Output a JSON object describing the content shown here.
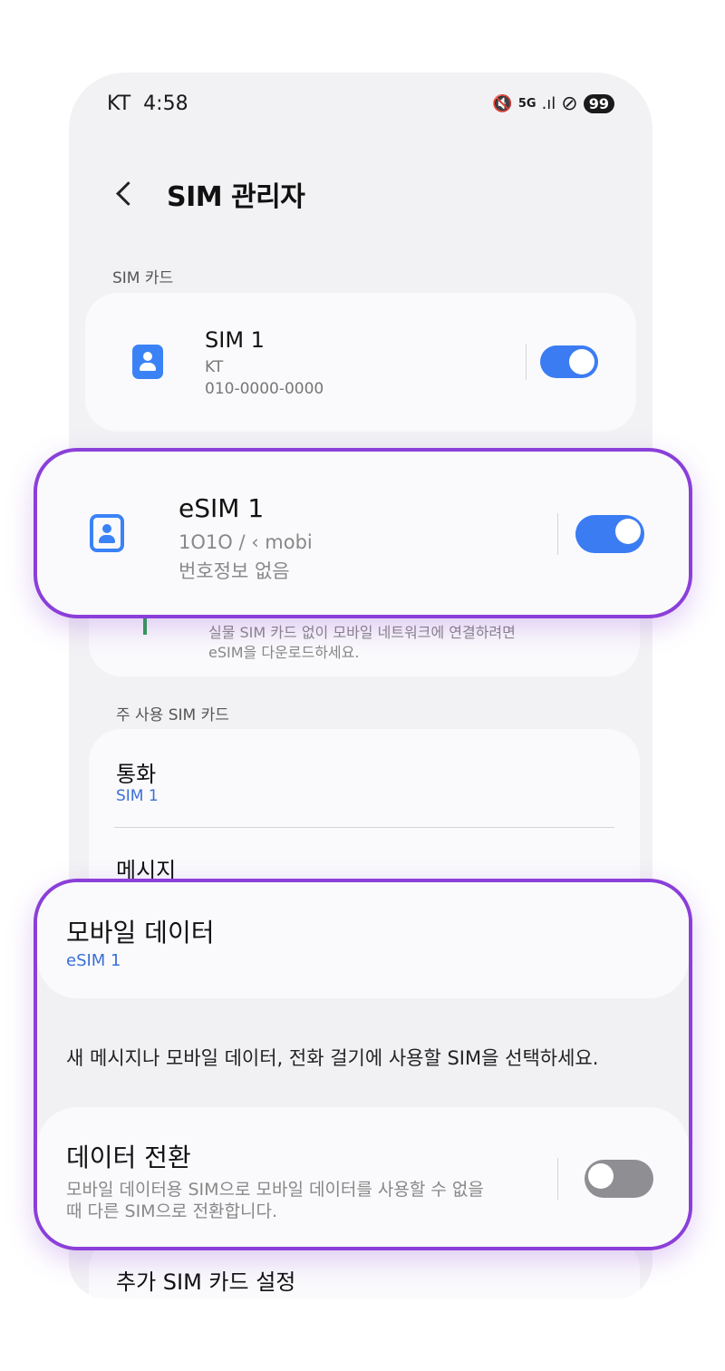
{
  "status_bar": {
    "carrier": "KT",
    "time": "4:58",
    "icons": [
      "mute-icon",
      "5g-icon",
      "signal-icon",
      "dnd-icon"
    ],
    "battery": "99"
  },
  "header": {
    "title": "SIM 관리자"
  },
  "sim_cards_section": {
    "label": "SIM 카드"
  },
  "sim1": {
    "name": "SIM 1",
    "carrier": "KT",
    "number": "010-0000-0000",
    "enabled": true
  },
  "esim1": {
    "name": "eSIM 1",
    "carrier": "1O1O / ‹ mobi",
    "number": "번호정보 없음",
    "enabled": true
  },
  "add_esim": {
    "description_line1": "실물 SIM 카드 없이 모바일 네트워크에 연결하려면",
    "description_line2": "eSIM을 다운로드하세요."
  },
  "primary_section": {
    "label": "주 사용 SIM 카드",
    "calls": {
      "label": "통화",
      "value": "SIM 1"
    },
    "messages": {
      "label": "메시지"
    }
  },
  "mobile_data": {
    "label": "모바일 데이터",
    "value": "eSIM 1"
  },
  "hint": "새 메시지나 모바일 데이터, 전화 걸기에 사용할 SIM을 선택하세요.",
  "data_switch": {
    "label": "데이터 전환",
    "description_line1": "모바일 데이터용 SIM으로 모바일 데이터를 사용할 수 없을",
    "description_line2": "때 다른 SIM으로 전환합니다.",
    "enabled": false
  },
  "more_settings": {
    "label": "추가 SIM 카드 설정"
  },
  "colors": {
    "accent": "#3b7cf3",
    "highlight": "#8b3fd9",
    "background": "#f2f2f4"
  }
}
